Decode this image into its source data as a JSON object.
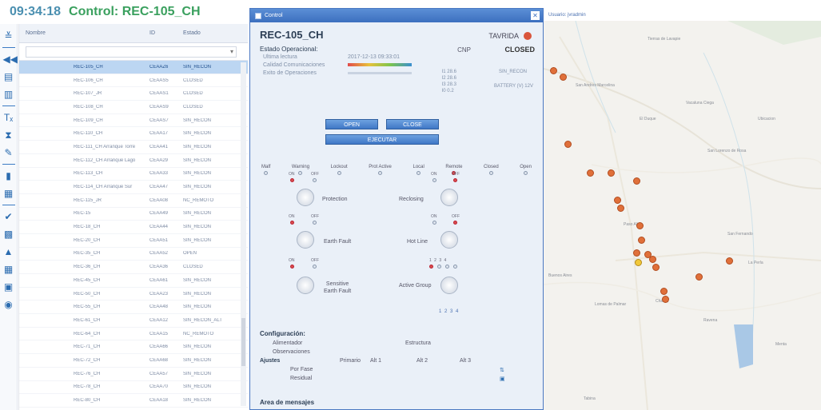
{
  "header": {
    "time": "09:34:18",
    "title": "Control: REC-105_CH"
  },
  "list": {
    "columns": [
      "Nombre",
      "ID",
      "Estado"
    ],
    "rows": [
      {
        "name": "REC-105_CH",
        "id": "CEAAZ6",
        "status": "SIN_RECON",
        "selected": true
      },
      {
        "name": "REC-106_CH",
        "id": "CEAAS5",
        "status": "CLOSED"
      },
      {
        "name": "REC-107_JR",
        "id": "CEAAS1",
        "status": "CLOSED"
      },
      {
        "name": "REC-108_CH",
        "id": "CEAAS9",
        "status": "CLOSED"
      },
      {
        "name": "REC-109_CH",
        "id": "CEAAS7",
        "status": "SIN_RECON"
      },
      {
        "name": "REC-110_CH",
        "id": "CEAA17",
        "status": "SIN_RECON"
      },
      {
        "name": "REC-111_CH Arranque Torre",
        "id": "CEAA41",
        "status": "SIN_RECON"
      },
      {
        "name": "REC-112_CH Arranque Lago",
        "id": "CEAA29",
        "status": "SIN_RECON"
      },
      {
        "name": "REC-113_CH",
        "id": "CEAA33",
        "status": "SIN_RECON"
      },
      {
        "name": "REC-114_CH Arranque Sur",
        "id": "CEAA47",
        "status": "SIN_RECON"
      },
      {
        "name": "REC-115_JR",
        "id": "CEAA08",
        "status": "NC_REMOTO"
      },
      {
        "name": "REC-15",
        "id": "CEAA49",
        "status": "SIN_RECON"
      },
      {
        "name": "REC-18_CH",
        "id": "CEAA44",
        "status": "SIN_RECON"
      },
      {
        "name": "REC-20_CH",
        "id": "CEAA51",
        "status": "SIN_RECON"
      },
      {
        "name": "REC-35_CH",
        "id": "CEAA52",
        "status": "OPEN"
      },
      {
        "name": "REC-36_CH",
        "id": "CEAA36",
        "status": "CLOSED"
      },
      {
        "name": "REC-45_CH",
        "id": "CEAA61",
        "status": "SIN_RECON"
      },
      {
        "name": "REC-50_CH",
        "id": "CEAA23",
        "status": "SIN_RECON"
      },
      {
        "name": "REC-55_CH",
        "id": "CEAA48",
        "status": "SIN_RECON"
      },
      {
        "name": "REC-61_CH",
        "id": "CEAA12",
        "status": "SIN_RECON_ALT"
      },
      {
        "name": "REC-64_CH",
        "id": "CEAA15",
        "status": "NC_REMOTO"
      },
      {
        "name": "REC-71_CH",
        "id": "CEAA66",
        "status": "SIN_RECON"
      },
      {
        "name": "REC-72_CH",
        "id": "CEAA68",
        "status": "SIN_RECON"
      },
      {
        "name": "REC-76_CH",
        "id": "CEAA57",
        "status": "SIN_RECON"
      },
      {
        "name": "REC-78_CH",
        "id": "CEAA70",
        "status": "SIN_RECON"
      },
      {
        "name": "REC-80_CH",
        "id": "CEAA18",
        "status": "SIN_RECON"
      }
    ]
  },
  "modal": {
    "window_title": "Control",
    "rec": "REC-105_CH",
    "brand": "TAVRIDA",
    "cnp": "CNP",
    "state": "CLOSED",
    "estado_label": "Estado Operacional:",
    "ultima_label": "Ultima lectura",
    "ultima_value": "2017-12-13 09:33:01",
    "calidad_label": "Calidad Comunicaciones",
    "exito_label": "Exito de Operaciones",
    "readings": [
      "I1  28.6",
      "I2  28.6",
      "I3  28.3",
      "I0  0.2"
    ],
    "status_code": "SIN_RECON",
    "battery": "BATTERY (V) 12V",
    "open_btn": "OPEN",
    "close_btn": "CLOSE",
    "exec_btn": "EJECUTAR",
    "leds": [
      {
        "label": "Malf",
        "on": false
      },
      {
        "label": "Warning",
        "on": false
      },
      {
        "label": "Lockout",
        "on": false
      },
      {
        "label": "Prot Active",
        "on": false
      },
      {
        "label": "Local",
        "on": false
      },
      {
        "label": "Remote",
        "on": true
      },
      {
        "label": "Closed",
        "on": false
      },
      {
        "label": "Open",
        "on": false
      }
    ],
    "on_label": "ON",
    "off_label": "OFF",
    "protection": "Protection",
    "reclosing": "Reclosing",
    "earth_fault": "Earth Fault",
    "hot_line": "Hot Line",
    "sensitive": "Sensitive\nEarth Fault",
    "active_group": "Active Group",
    "group_nums": "1  2  3  4",
    "group_nums_bottom": "1  2  3  4",
    "configuracion": "Configuración:",
    "alimentador": "Alimentador",
    "estructura": "Estructura",
    "observaciones": "Observaciones",
    "ajustes": "Ajustes",
    "primario": "Primario",
    "alt1": "Alt 1",
    "alt2": "Alt 2",
    "alt3": "Alt 3",
    "por_fase": "Por Fase",
    "residual": "Residual",
    "area_mensajes": "Area de mensajes"
  },
  "map": {
    "user": "Usuario: jvradmin",
    "places": [
      "Tierras de Lavapie",
      "San Andres Marcelina",
      "El Duque",
      "Vacaluna Ciega",
      "Ubicacion",
      "San Lorenzo de Rosa",
      "Paso Alto",
      "San Fernando",
      "La Perla",
      "Buenos Aires",
      "Charca",
      "Lomas de Palmar",
      "Ravena",
      "Menta",
      "Tabina"
    ]
  }
}
